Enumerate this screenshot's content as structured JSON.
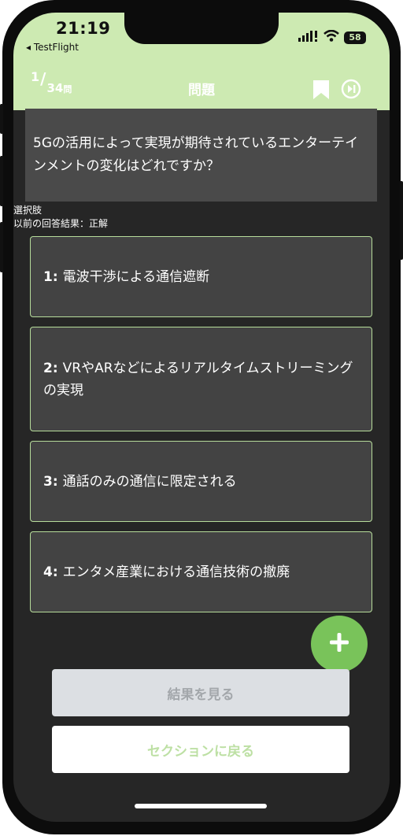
{
  "status": {
    "time": "21:19",
    "back_app": "◂ TestFlight",
    "battery": "58"
  },
  "header": {
    "counter_current": "1",
    "counter_total": "34",
    "counter_unit": "問",
    "title": "問題"
  },
  "question": {
    "text": "5Gの活用によって実現が期待されているエンターテインメントの変化はどれですか？"
  },
  "choices_label": "選択肢",
  "previous_result": "以前の回答結果：正解",
  "choices": [
    {
      "num": "1:",
      "text": "電波干渉による通信遮断"
    },
    {
      "num": "2:",
      "text": "VRやARなどによるリアルタイムストリーミングの実現"
    },
    {
      "num": "3:",
      "text": "通話のみの通信に限定される"
    },
    {
      "num": "4:",
      "text": "エンタメ産業における通信技術の撤廃"
    }
  ],
  "buttons": {
    "see_results": "結果を見る",
    "back_to_section": "セクションに戻る"
  },
  "icons": {
    "bookmark": "bookmark-icon",
    "skip": "skip-forward-icon",
    "add": "plus-icon",
    "signal": "signal-icon",
    "wifi": "wifi-icon"
  },
  "colors": {
    "accent": "#cdeab2",
    "fab": "#79c35a",
    "choice_border": "#b7dd9b",
    "background": "#262626"
  }
}
